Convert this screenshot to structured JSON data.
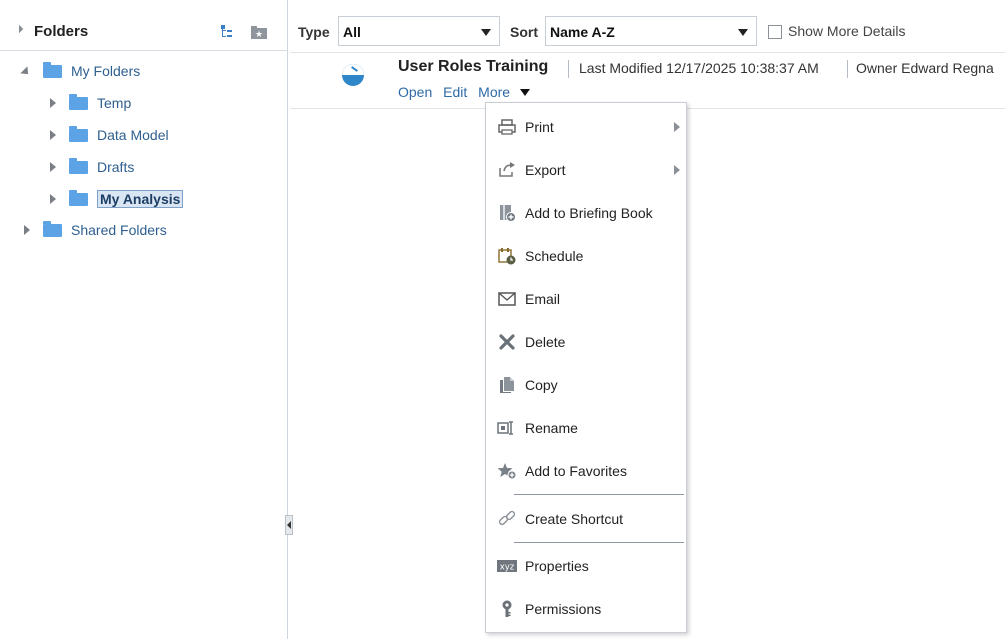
{
  "left_panel": {
    "title": "Folders",
    "tree": [
      {
        "label": "My Folders",
        "expanded": true
      },
      {
        "label": "Temp"
      },
      {
        "label": "Data Model"
      },
      {
        "label": "Drafts"
      },
      {
        "label": "My Analysis",
        "selected": true
      },
      {
        "label": "Shared Folders"
      }
    ]
  },
  "filter_bar": {
    "type_label": "Type",
    "type_value": "All",
    "sort_label": "Sort",
    "sort_value": "Name A-Z",
    "show_more_details": "Show More Details"
  },
  "item": {
    "title": "User Roles Training",
    "last_modified": "Last Modified 12/17/2025 10:38:37 AM",
    "owner": "Owner Edward Regna",
    "links": [
      "Open",
      "Edit",
      "More"
    ]
  },
  "menu": {
    "items": [
      {
        "label": "Print",
        "icon": "print-icon",
        "submenu": true
      },
      {
        "label": "Export",
        "icon": "export-icon",
        "submenu": true
      },
      {
        "label": "Add to Briefing Book",
        "icon": "briefing-book-icon"
      },
      {
        "label": "Schedule",
        "icon": "schedule-icon",
        "highlighted": true
      },
      {
        "label": "Email",
        "icon": "email-icon"
      },
      {
        "label": "Delete",
        "icon": "delete-icon"
      },
      {
        "label": "Copy",
        "icon": "copy-icon"
      },
      {
        "label": "Rename",
        "icon": "rename-icon"
      },
      {
        "label": "Add to Favorites",
        "icon": "favorites-icon"
      },
      {
        "label": "Create Shortcut",
        "icon": "shortcut-icon"
      },
      {
        "label": "Properties",
        "icon": "properties-icon"
      },
      {
        "label": "Permissions",
        "icon": "permissions-icon"
      }
    ]
  },
  "colors": {
    "link": "#2f6aa7",
    "folder": "#5ca3e6",
    "highlight": "#ffef32",
    "selected_bg": "#d9e5f3"
  }
}
